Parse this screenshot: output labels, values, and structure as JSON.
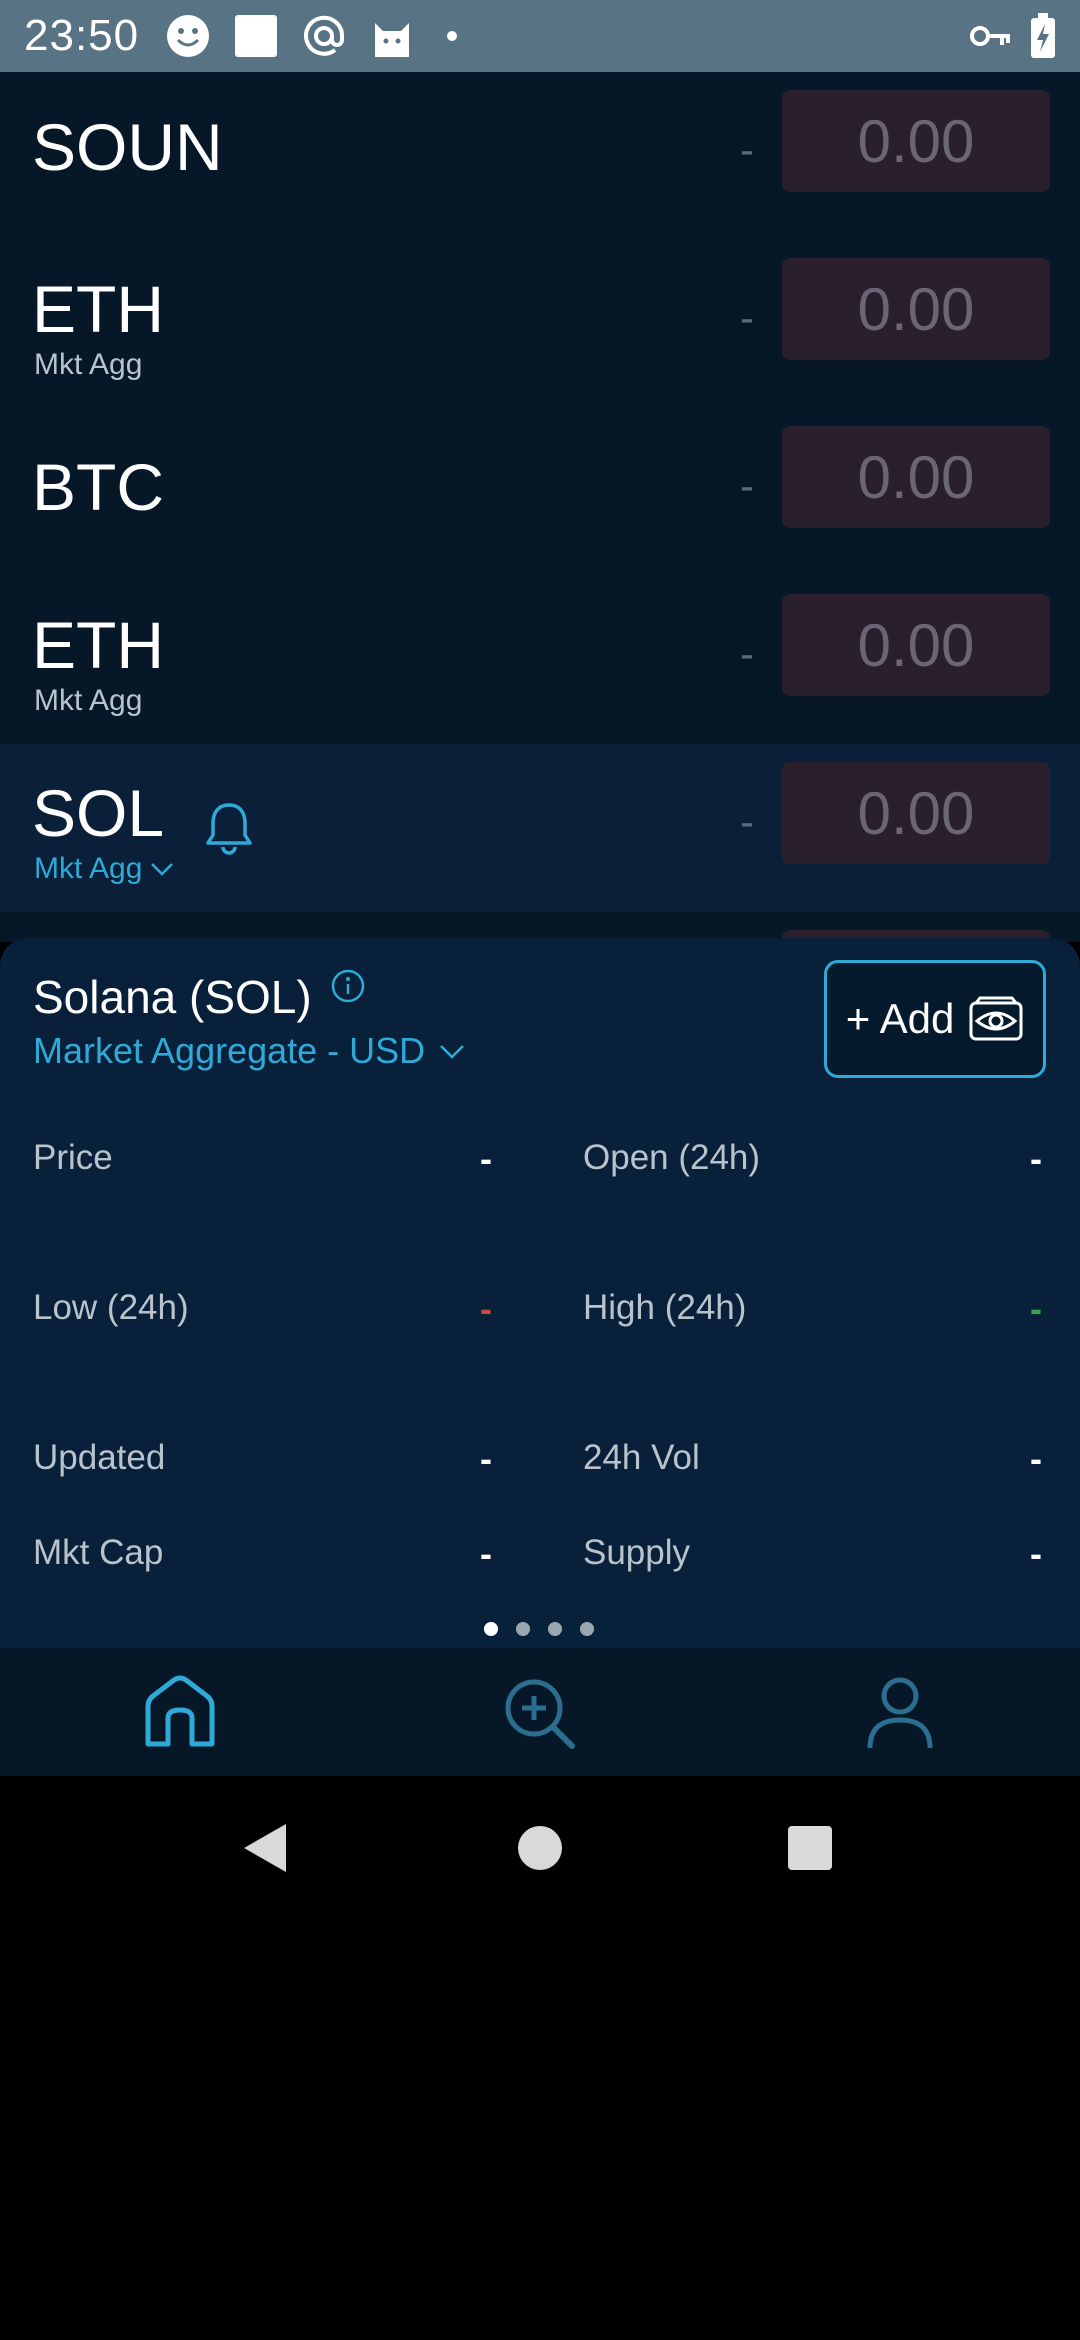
{
  "status_bar": {
    "time": "23:50",
    "left_icons": [
      "smiley-icon",
      "square-icon",
      "at-sign-icon",
      "cat-icon",
      "dot-icon"
    ],
    "right_icons": [
      "key-icon",
      "battery-charging-icon"
    ]
  },
  "watchlist": {
    "rows": [
      {
        "symbol": "SOUN",
        "exchange": "",
        "change": "-",
        "price": "0.00"
      },
      {
        "symbol": "ETH",
        "exchange": "Mkt Agg",
        "change": "-",
        "price": "0.00"
      },
      {
        "symbol": "BTC",
        "exchange": "",
        "change": "-",
        "price": "0.00"
      },
      {
        "symbol": "ETH",
        "exchange": "Mkt Agg",
        "change": "-",
        "price": "0.00"
      },
      {
        "symbol": "SOL",
        "exchange": "Mkt Agg",
        "change": "-",
        "price": "0.00"
      }
    ]
  },
  "details": {
    "title": "Solana (SOL)",
    "market": "Market Aggregate - USD",
    "add_label": "+ Add",
    "stats": {
      "price_label": "Price",
      "price_value": "-",
      "open_label": "Open (24h)",
      "open_value": "-",
      "low_label": "Low (24h)",
      "low_value": "-",
      "high_label": "High (24h)",
      "high_value": "-",
      "updated_label": "Updated",
      "updated_value": "-",
      "vol_label": "24h Vol",
      "vol_value": "-",
      "mktcap_label": "Mkt Cap",
      "mktcap_value": "-",
      "supply_label": "Supply",
      "supply_value": "-"
    },
    "pager": {
      "pages": 4,
      "active": 1
    }
  },
  "colors": {
    "accent": "#2fa9d8",
    "background": "#061727",
    "sheet": "#082039",
    "price_box": "#2a202d",
    "negative": "#d04545",
    "positive": "#2ea84e"
  },
  "bottom_nav": {
    "items": [
      "home-icon",
      "search-add-icon",
      "profile-icon"
    ],
    "active": "home-icon"
  }
}
